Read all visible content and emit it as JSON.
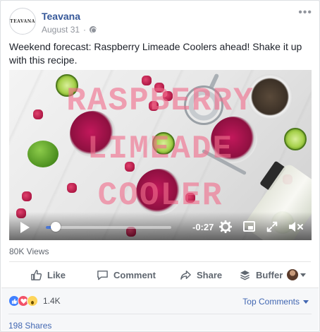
{
  "post": {
    "page_name": "Teavana",
    "avatar_text": "TEAVANA",
    "date": "August 31",
    "text": "Weekend forecast: Raspberry Limeade Coolers ahead! Shake it up with this recipe."
  },
  "video": {
    "overlay_lines": [
      "RASPBERRY",
      "LIMEADE",
      "COOLER"
    ],
    "time_remaining": "-0:27",
    "progress": 0.08
  },
  "stats": {
    "views": "80K Views",
    "reactions_count": "1.4K",
    "shares": "198 Shares"
  },
  "actions": {
    "like": "Like",
    "comment": "Comment",
    "share": "Share",
    "buffer": "Buffer"
  },
  "sort": {
    "label": "Top Comments"
  },
  "colors": {
    "link": "#365899",
    "accent": "#4267b2",
    "overlay_text": "#f06e8c"
  }
}
